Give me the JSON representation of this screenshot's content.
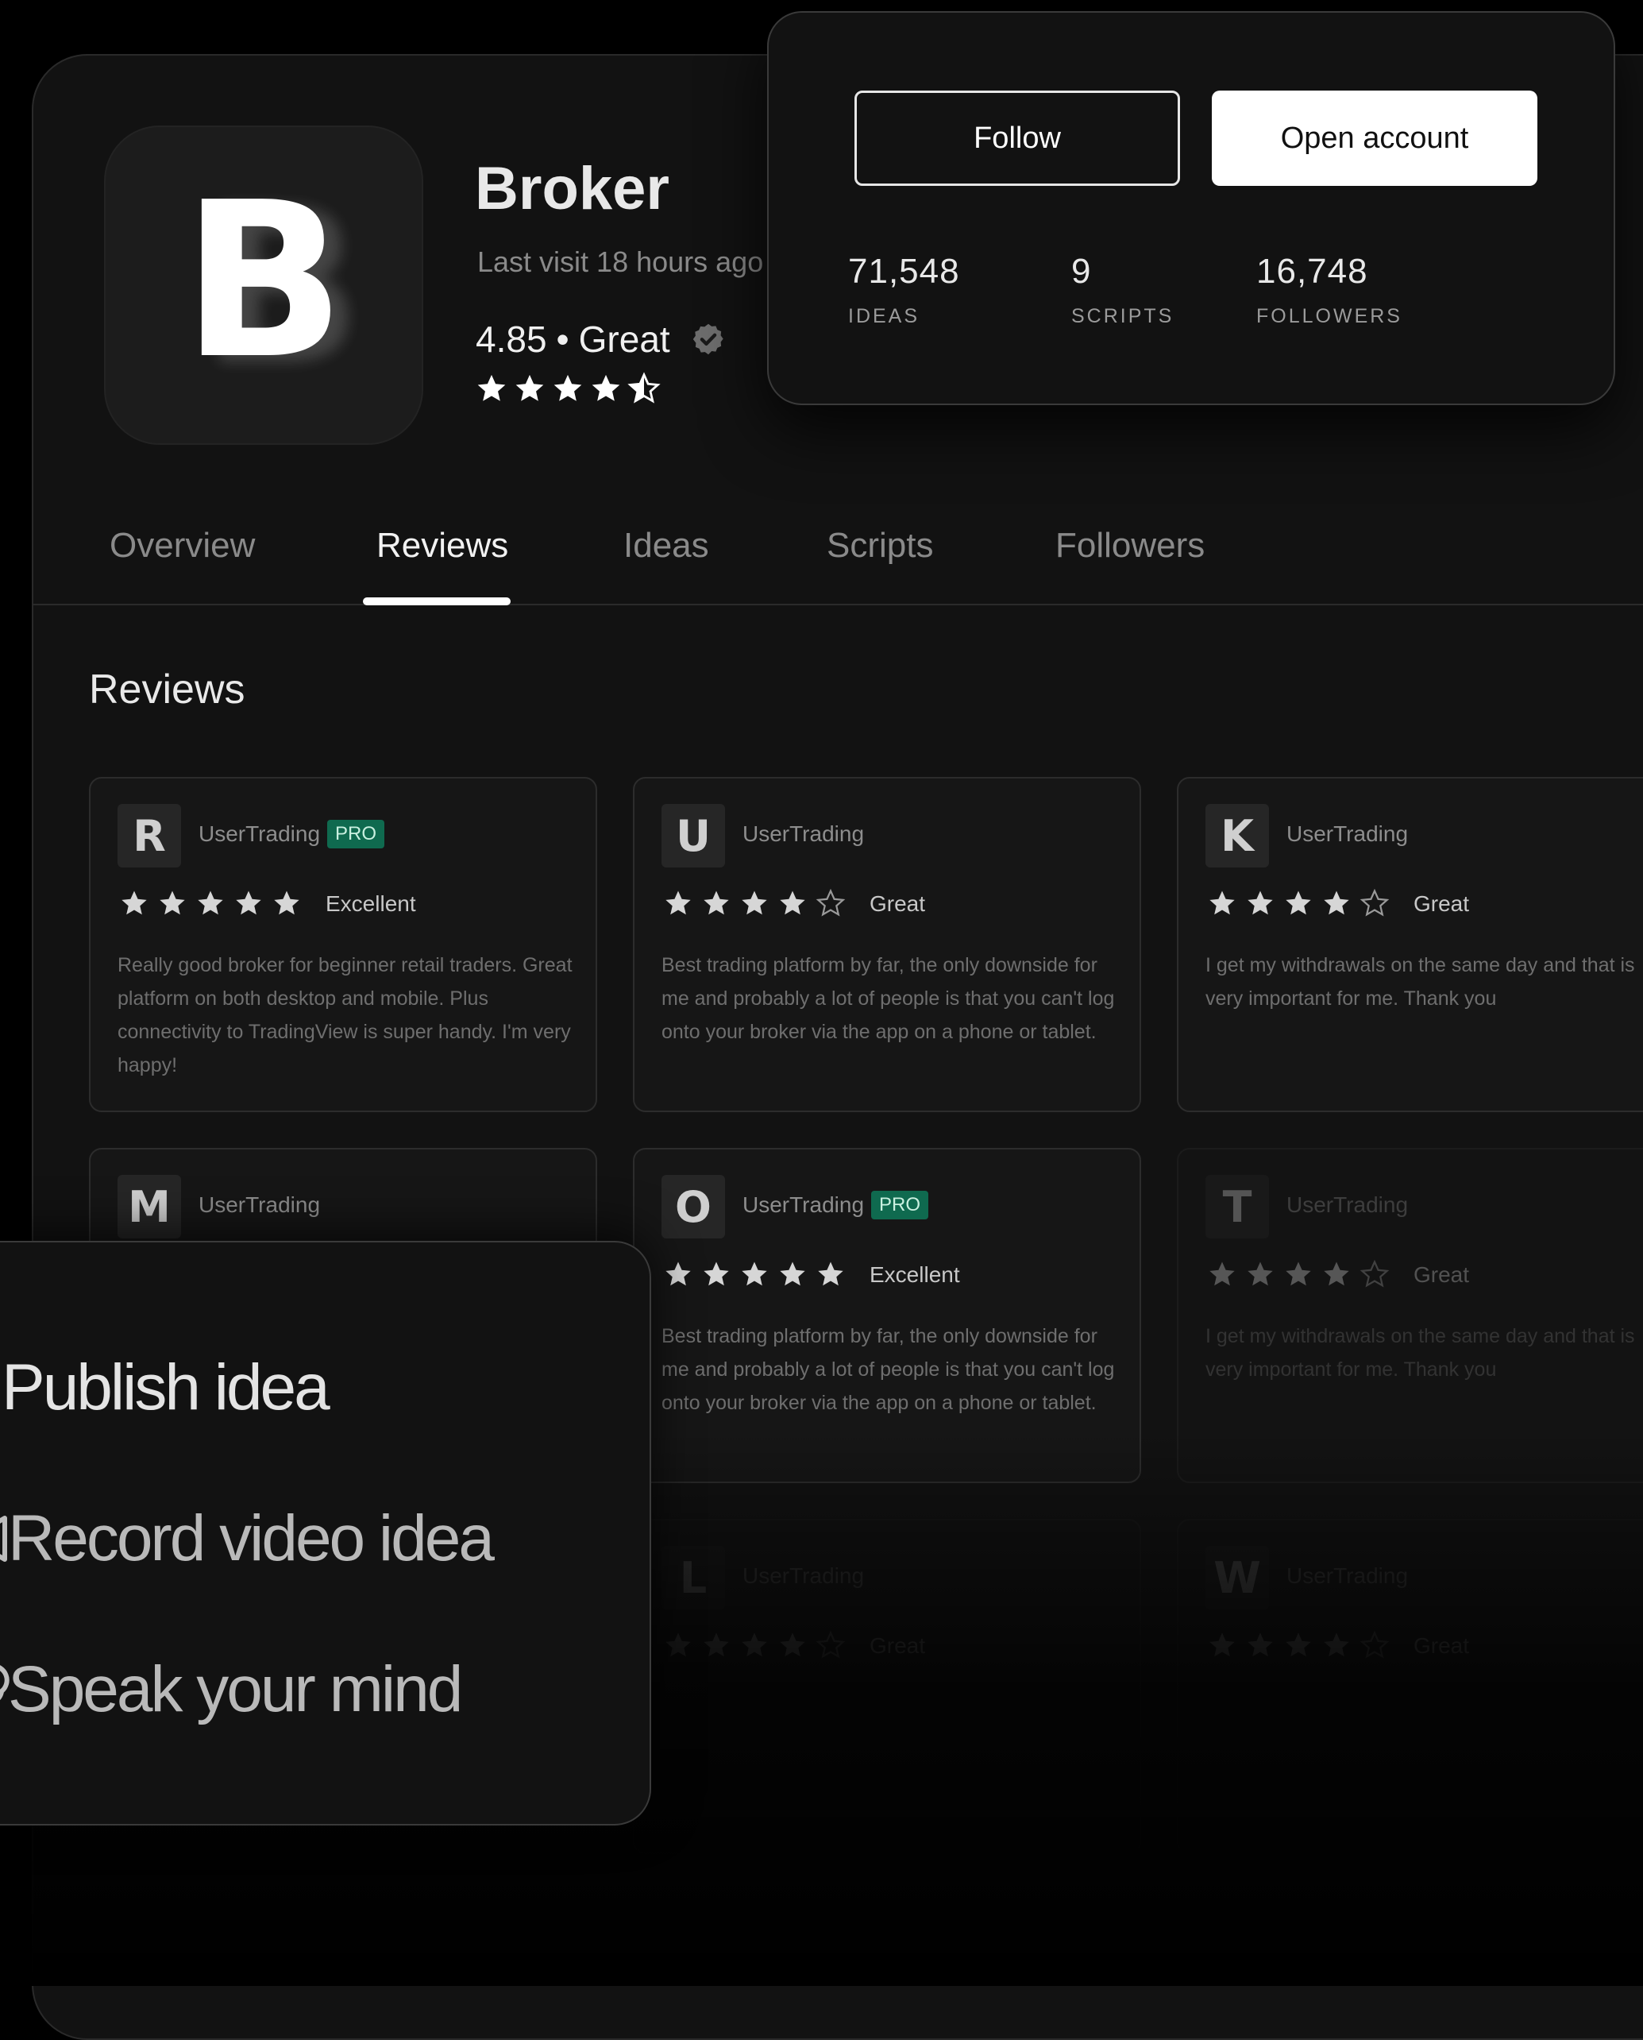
{
  "profile": {
    "logo_letter": "B",
    "name": "Broker",
    "last_visit": "Last visit 18 hours ago",
    "rating_value": "4.85",
    "rating_separator": "•",
    "rating_label": "Great",
    "rating_stars": 4.5
  },
  "actions": {
    "follow_label": "Follow",
    "open_account_label": "Open account"
  },
  "stats": [
    {
      "value": "71,548",
      "label": "IDEAS"
    },
    {
      "value": "9",
      "label": "SCRIPTS"
    },
    {
      "value": "16,748",
      "label": "FOLLOWERS"
    }
  ],
  "tabs": [
    {
      "label": "Overview",
      "active": false
    },
    {
      "label": "Reviews",
      "active": true
    },
    {
      "label": "Ideas",
      "active": false
    },
    {
      "label": "Scripts",
      "active": false
    },
    {
      "label": "Followers",
      "active": false
    }
  ],
  "reviews_heading": "Reviews",
  "reviews": [
    {
      "initial": "R",
      "user": "UserTrading",
      "pro": "PRO",
      "stars": 5,
      "label": "Excellent",
      "text": "Really good broker for beginner retail traders. Great platform on both desktop and mobile. Plus connectivity to TradingView is super handy. I'm very happy!"
    },
    {
      "initial": "U",
      "user": "UserTrading",
      "pro": "",
      "stars": 4,
      "label": "Great",
      "text": "Best trading platform by far, the only downside for me and probably a lot of people is that you can't log onto your broker via the app on a phone or tablet."
    },
    {
      "initial": "K",
      "user": "UserTrading",
      "pro": "",
      "stars": 4,
      "label": "Great",
      "text": "I get my withdrawals on the same day and that is very important for me. Thank you"
    },
    {
      "initial": "M",
      "user": "UserTrading",
      "pro": "",
      "stars": 0,
      "label": "",
      "text": ""
    },
    {
      "initial": "O",
      "user": "UserTrading",
      "pro": "PRO",
      "stars": 5,
      "label": "Excellent",
      "text": "Best trading platform by far, the only downside for me and probably a lot of people is that you can't log onto your broker via the app on a phone or tablet."
    },
    {
      "initial": "T",
      "user": "UserTrading",
      "pro": "",
      "stars": 4,
      "label": "Great",
      "text": "I get my withdrawals on the same day and that is very important for me. Thank you"
    },
    {
      "initial": "L",
      "user": "UserTrading",
      "pro": "",
      "stars": 4,
      "label": "Great",
      "text": ""
    },
    {
      "initial": "W",
      "user": "UserTrading",
      "pro": "",
      "stars": 4,
      "label": "Great",
      "text": ""
    }
  ],
  "menu": [
    {
      "label": "Publish idea",
      "icon": "lightbulb-icon"
    },
    {
      "label": "Record video idea",
      "icon": "video-camera-icon"
    },
    {
      "label": "Speak your mind",
      "icon": "thought-bubble-icon"
    }
  ],
  "colors": {
    "background": "#000000",
    "card": "#121212",
    "pro_badge": "#0f6a4f",
    "accent_white": "#ffffff"
  }
}
